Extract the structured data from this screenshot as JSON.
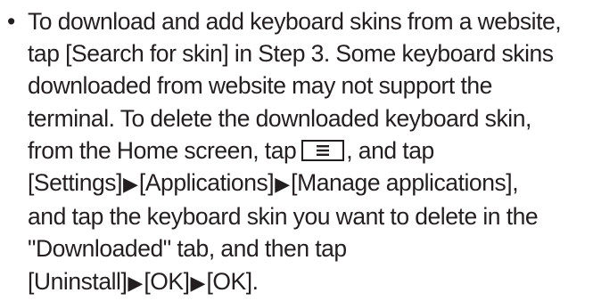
{
  "note": {
    "bullet": "•",
    "lines": [
      "To download and add keyboard skins from a website,",
      "tap [Search for skin] in Step 3. Some keyboard skins",
      "downloaded from website may not support the",
      "terminal. To delete the downloaded keyboard skin,",
      "from the Home screen, tap",
      ", and tap",
      "[Settings]",
      "[Applications]",
      "[Manage applications],",
      "and tap the keyboard skin you want to delete in the",
      "\"Downloaded\" tab, and then tap",
      "[Uninstall]",
      "[OK]",
      "[OK]."
    ],
    "arrow": "▶",
    "menu_key_icon": "menu-key-icon"
  }
}
